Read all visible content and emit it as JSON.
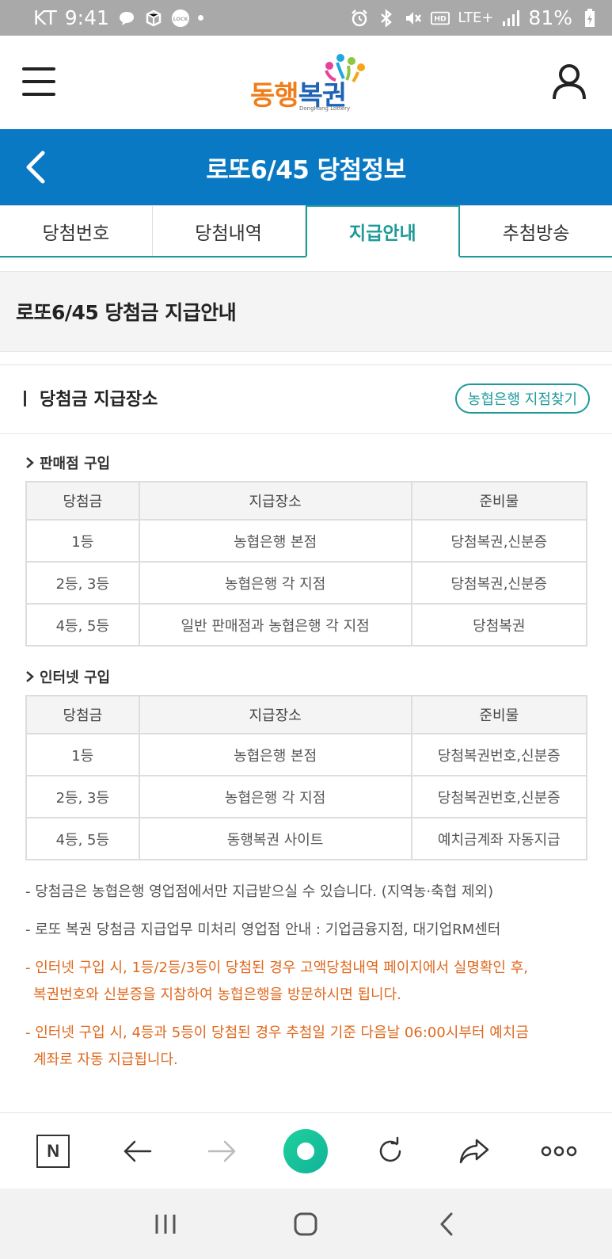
{
  "status_bar": {
    "carrier": "KT",
    "time": "9:41",
    "battery": "81%",
    "network": "LTE+"
  },
  "header": {
    "logo": {
      "text_part1": "동행",
      "text_part2": "복권",
      "subtext": "DongHang Lottery"
    }
  },
  "title_bar": {
    "title": "로또6/45 당첨정보"
  },
  "tabs": [
    {
      "label": "당첨번호",
      "active": false
    },
    {
      "label": "당첨내역",
      "active": false
    },
    {
      "label": "지급안내",
      "active": true
    },
    {
      "label": "추첨방송",
      "active": false
    }
  ],
  "page_heading": "로또6/45 당첨금 지급안내",
  "section": {
    "title": "당첨금 지급장소",
    "find_button": "농협은행 지점찾기",
    "store": {
      "heading": "판매점 구입",
      "columns": [
        "당첨금",
        "지급장소",
        "준비물"
      ],
      "rows": [
        [
          "1등",
          "농협은행 본점",
          "당첨복권,신분증"
        ],
        [
          "2등, 3등",
          "농협은행 각 지점",
          "당첨복권,신분증"
        ],
        [
          "4등, 5등",
          "일반 판매점과 농협은행 각 지점",
          "당첨복권"
        ]
      ]
    },
    "internet": {
      "heading": "인터넷 구입",
      "columns": [
        "당첨금",
        "지급장소",
        "준비물"
      ],
      "rows": [
        [
          "1등",
          "농협은행 본점",
          "당첨복권번호,신분증"
        ],
        [
          "2등, 3등",
          "농협은행 각 지점",
          "당첨복권번호,신분증"
        ],
        [
          "4등, 5등",
          "동행복권 사이트",
          "예치금계좌 자동지급"
        ]
      ]
    },
    "notes": [
      {
        "line1": "- 당첨금은 농협은행 영업점에서만 지급받으실 수 있습니다. (지역농·축협 제외)",
        "line2": "",
        "highlight": false
      },
      {
        "line1": "- 로또 복권 당첨금 지급업무 미처리 영업점 안내 : 기업금융지점, 대기업RM센터",
        "line2": "",
        "highlight": false
      },
      {
        "line1": "- 인터넷 구입 시, 1등/2등/3등이 당첨된 경우 고액당첨내역 페이지에서 실명확인 후,",
        "line2": "복권번호와 신분증을 지참하여 농협은행을 방문하시면 됩니다.",
        "highlight": true
      },
      {
        "line1": "- 인터넷 구입 시, 4등과 5등이 당첨된 경우 추첨일 기준 다음날 06:00시부터 예치금",
        "line2": "계좌로 자동 지급됩니다.",
        "highlight": true
      }
    ]
  },
  "browser_bar": {
    "home_label": "N"
  },
  "colors": {
    "title_bar": "#0a79c4",
    "accent": "#1f9a9a",
    "highlight_text": "#e0691f",
    "logo_orange": "#f07d1a",
    "logo_blue": "#1f63b5"
  }
}
